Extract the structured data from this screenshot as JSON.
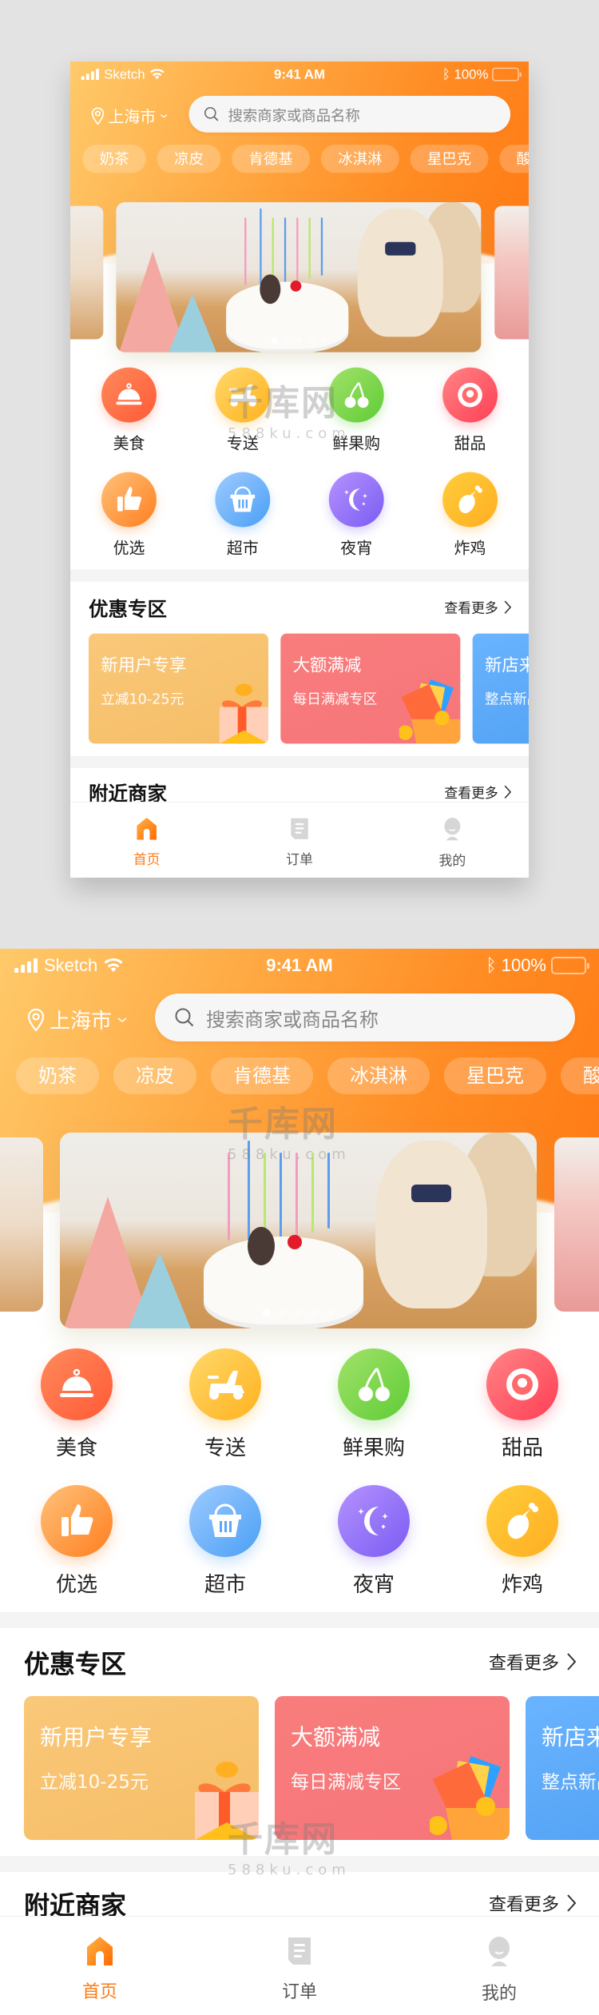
{
  "status": {
    "carrier": "Sketch",
    "time": "9:41 AM",
    "battery": "100%"
  },
  "header": {
    "location": "上海市",
    "search_placeholder": "搜索商家或商品名称",
    "tags": [
      "奶茶",
      "凉皮",
      "肯德基",
      "冰淇淋",
      "星巴克",
      "酸奶"
    ]
  },
  "banner": {
    "slide_count": 5,
    "active_index": 0
  },
  "categories": [
    {
      "label": "美食",
      "icon": "food-cloche-icon",
      "c1": "#ff8a5c",
      "c2": "#ff5a36"
    },
    {
      "label": "专送",
      "icon": "scooter-icon",
      "c1": "#ffd86a",
      "c2": "#ffb21f"
    },
    {
      "label": "鲜果购",
      "icon": "cherry-icon",
      "c1": "#a2e26a",
      "c2": "#5fcc36"
    },
    {
      "label": "甜品",
      "icon": "donut-icon",
      "c1": "#ff8585",
      "c2": "#ff3e55"
    },
    {
      "label": "优选",
      "icon": "thumbs-up-icon",
      "c1": "#ffc27a",
      "c2": "#ff7e1f"
    },
    {
      "label": "超市",
      "icon": "basket-icon",
      "c1": "#9ecbff",
      "c2": "#4a9ff5"
    },
    {
      "label": "夜宵",
      "icon": "moon-icon",
      "c1": "#b592ff",
      "c2": "#7a5cf2"
    },
    {
      "label": "炸鸡",
      "icon": "drumstick-icon",
      "c1": "#ffcd3a",
      "c2": "#ffae22"
    }
  ],
  "promo_section": {
    "title": "优惠专区",
    "more": "查看更多",
    "cards": [
      {
        "title": "新用户专享",
        "subtitle": "立减10-25元",
        "color1": "#f9c879",
        "color2": "#f6bd66"
      },
      {
        "title": "大额满减",
        "subtitle": "每日满减专区",
        "color1": "#f97d7d",
        "color2": "#f6757a"
      },
      {
        "title": "新店来袭",
        "subtitle": "整点新品",
        "color1": "#6ab4ff",
        "color2": "#4e9ef2"
      }
    ]
  },
  "nearby_section": {
    "title": "附近商家",
    "more": "查看更多"
  },
  "tabbar": {
    "items": [
      {
        "label": "首页",
        "icon": "home-icon",
        "active": true
      },
      {
        "label": "订单",
        "icon": "order-icon",
        "active": false
      },
      {
        "label": "我的",
        "icon": "profile-icon",
        "active": false
      }
    ],
    "accent": "#ff7a14"
  },
  "watermark": {
    "brand": "千库网",
    "url": "588ku.com"
  }
}
